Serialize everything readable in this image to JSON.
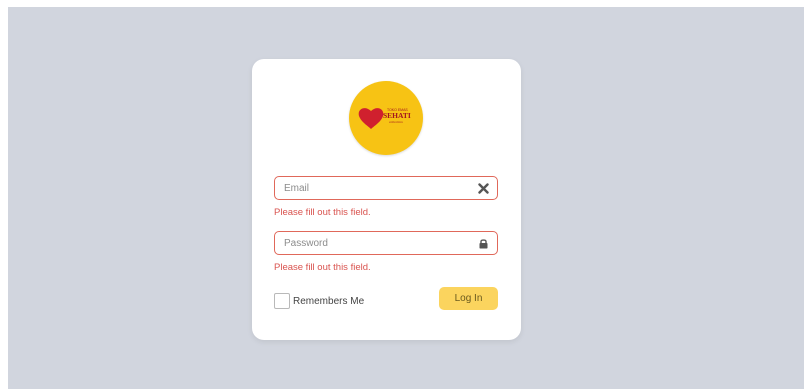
{
  "login": {
    "logo": {
      "name": "sehati-logo",
      "text_top": "TOKO EMAS",
      "text_main": "SEHATI",
      "text_bottom": "collection"
    },
    "email": {
      "placeholder": "Email",
      "value": "",
      "icon": "times-icon",
      "error": "Please fill out this field."
    },
    "password": {
      "placeholder": "Password",
      "value": "",
      "icon": "lock-icon",
      "error": "Please fill out this field."
    },
    "remember_label": "Remembers Me",
    "remember_checked": false,
    "submit_label": "Log In"
  },
  "colors": {
    "background": "#d1d5de",
    "card": "#ffffff",
    "logo_circle": "#f7c314",
    "heart": "#d0202e",
    "error": "#d9534f",
    "field_border_error": "#e0685a",
    "button": "#fbd45e"
  }
}
